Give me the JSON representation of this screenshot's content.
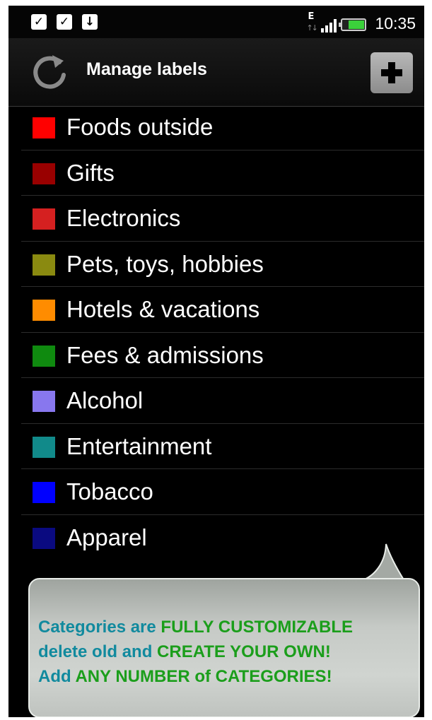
{
  "status_bar": {
    "notification_icons": [
      "check-bag-icon",
      "check-bag-icon",
      "download-bag-icon"
    ],
    "network_type": "E",
    "time": "10:35"
  },
  "header": {
    "title": "Manage labels"
  },
  "labels": [
    {
      "name": "Foods outside",
      "color": "#ff0000"
    },
    {
      "name": "Gifts",
      "color": "#990000"
    },
    {
      "name": "Electronics",
      "color": "#d52020"
    },
    {
      "name": "Pets, toys, hobbies",
      "color": "#8a8a10"
    },
    {
      "name": "Hotels & vacations",
      "color": "#ff8c00"
    },
    {
      "name": "Fees & admissions",
      "color": "#0f8a0f"
    },
    {
      "name": "Alcohol",
      "color": "#8877ee"
    },
    {
      "name": "Entertainment",
      "color": "#118a8a"
    },
    {
      "name": "Tobacco",
      "color": "#0000ff"
    },
    {
      "name": "Apparel",
      "color": "#0a0a80"
    }
  ],
  "promo": {
    "line1_a": "Categories are ",
    "line1_b": "FULLY CUSTOMIZABLE",
    "line2_a": "delete old and ",
    "line2_b": "CREATE YOUR OWN!",
    "line3_a": "Add ",
    "line3_b": "ANY NUMBER of CATEGORIES!",
    "colors": {
      "teal": "#118a9e",
      "green": "#1b9e1b"
    }
  }
}
